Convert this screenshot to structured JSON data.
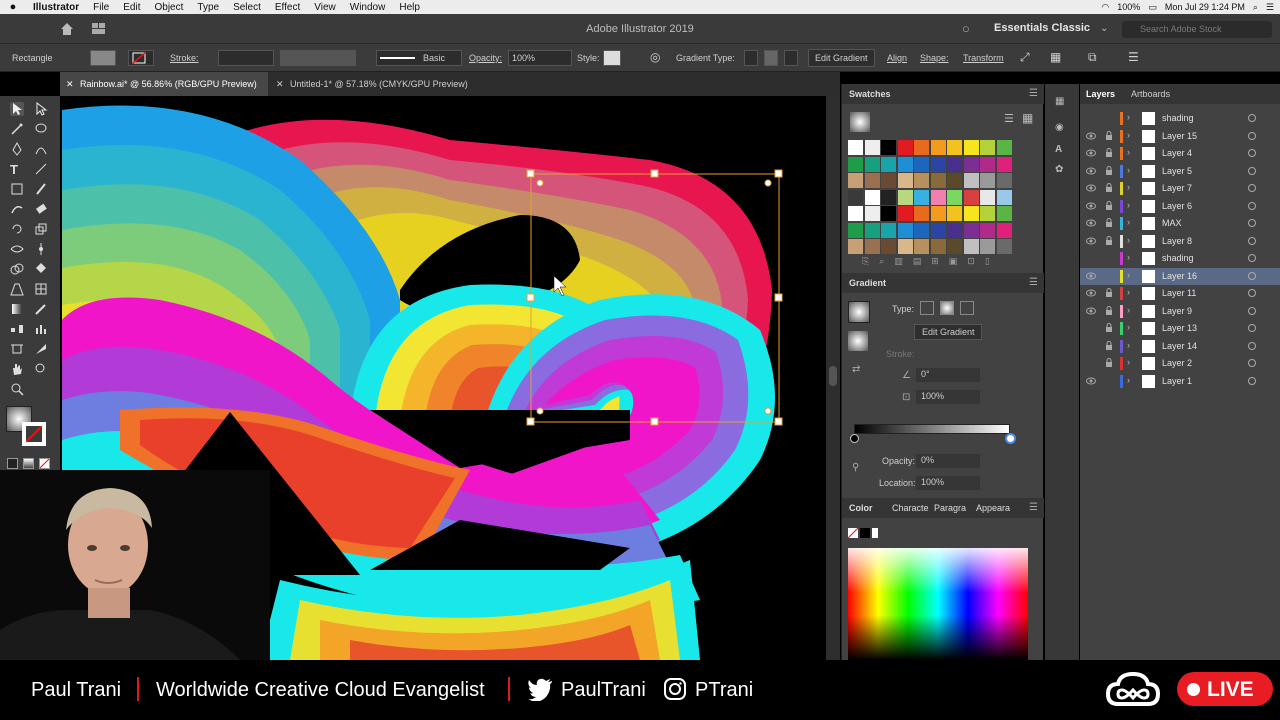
{
  "menubar": {
    "apple_icon": "apple-icon",
    "items": [
      "Illustrator",
      "File",
      "Edit",
      "Object",
      "Type",
      "Select",
      "Effect",
      "View",
      "Window",
      "Help"
    ],
    "battery": "100%",
    "clock": "Mon Jul 29  1:24 PM"
  },
  "titlebar": {
    "title": "Adobe Illustrator 2019",
    "workspace": "Essentials Classic",
    "search_placeholder": "Search Adobe Stock"
  },
  "controlbar": {
    "selection_label": "Rectangle",
    "stroke_label": "Stroke:",
    "brush_label": "Basic",
    "opacity_label": "Opacity:",
    "opacity_value": "100%",
    "style_label": "Style:",
    "gradient_type_label": "Gradient Type:",
    "edit_gradient": "Edit Gradient",
    "align": "Align",
    "shape": "Shape:",
    "transform": "Transform"
  },
  "tabs": [
    {
      "label": "Rainbow.ai* @ 56.86% (RGB/GPU Preview)",
      "active": true
    },
    {
      "label": "Untitled-1* @ 57.18% (CMYK/GPU Preview)",
      "active": false
    }
  ],
  "swatches": {
    "title": "Swatches"
  },
  "gradient": {
    "title": "Gradient",
    "type_label": "Type:",
    "edit_button": "Edit Gradient",
    "stroke_label": "Stroke:",
    "angle": "0°",
    "aspect": "100%",
    "opacity_label": "Opacity:",
    "opacity_value": "0%",
    "location_label": "Location:",
    "location_value": "100%"
  },
  "color_panel": {
    "tabs": [
      "Color",
      "Characte",
      "Paragra",
      "Appeara"
    ]
  },
  "layers": {
    "tabs": [
      "Layers",
      "Artboards"
    ],
    "items": [
      {
        "name": "shading",
        "color": "#e8731e",
        "eye": false,
        "lock": false
      },
      {
        "name": "Layer 15",
        "color": "#e8731e",
        "eye": true,
        "lock": true
      },
      {
        "name": "Layer 4",
        "color": "#e8731e",
        "eye": true,
        "lock": true
      },
      {
        "name": "Layer 5",
        "color": "#4a7be0",
        "eye": true,
        "lock": true
      },
      {
        "name": "Layer 7",
        "color": "#e0d02a",
        "eye": true,
        "lock": true
      },
      {
        "name": "Layer 6",
        "color": "#7a48d8",
        "eye": true,
        "lock": true
      },
      {
        "name": "MAX",
        "color": "#35b6d8",
        "eye": true,
        "lock": true
      },
      {
        "name": "Layer 8",
        "color": "#e0e0e0",
        "eye": true,
        "lock": true
      },
      {
        "name": "shading",
        "color": "#c83ad2",
        "eye": false,
        "lock": false
      },
      {
        "name": "Layer 16",
        "color": "#e8e026",
        "eye": true,
        "lock": false,
        "selected": true
      },
      {
        "name": "Layer 11",
        "color": "#d84040",
        "eye": true,
        "lock": true
      },
      {
        "name": "Layer 9",
        "color": "#ff9ec4",
        "eye": true,
        "lock": true
      },
      {
        "name": "Layer 13",
        "color": "#3ad06a",
        "eye": false,
        "lock": true
      },
      {
        "name": "Layer 14",
        "color": "#6b5bd0",
        "eye": false,
        "lock": true
      },
      {
        "name": "Layer 2",
        "color": "#e03030",
        "eye": false,
        "lock": true
      },
      {
        "name": "Layer 1",
        "color": "#3a6ae0",
        "eye": true,
        "lock": false
      }
    ]
  },
  "lower_third": {
    "name": "Paul Trani",
    "title": "Worldwide Creative Cloud Evangelist",
    "twitter": "PaulTrani",
    "instagram": "PTrani",
    "live": "LIVE"
  },
  "colors": {
    "live_red": "#e81c23",
    "selected_layer": "#5a6a86"
  }
}
